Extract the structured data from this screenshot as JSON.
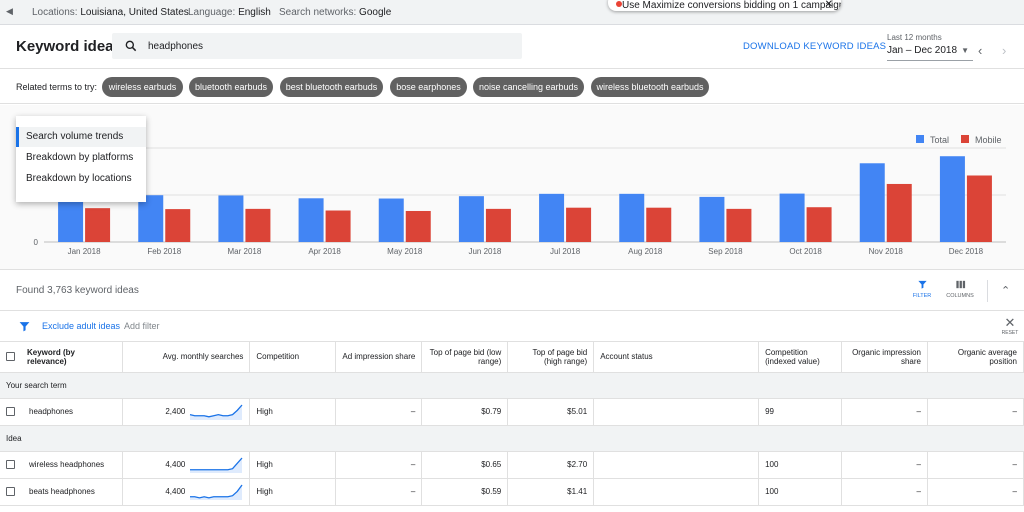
{
  "topbar": {
    "location_label": "Locations:",
    "location_value": "Louisiana, United States",
    "language_label": "Language:",
    "language_value": "English",
    "networks_label": "Search networks:",
    "networks_value": "Google",
    "toast_text": "Use Maximize conversions bidding on 1 campaign"
  },
  "header": {
    "title": "Keyword ideas",
    "search_value": "headphones",
    "download_label": "DOWNLOAD KEYWORD IDEAS",
    "range_label": "Last 12 months",
    "range_value": "Jan – Dec 2018"
  },
  "related": {
    "label": "Related terms to try:",
    "chips": [
      "wireless earbuds",
      "bluetooth earbuds",
      "best bluetooth earbuds",
      "bose earphones",
      "noise cancelling earbuds",
      "wireless bluetooth earbuds"
    ]
  },
  "chart_menu": {
    "items": [
      "Search volume trends",
      "Breakdown by platforms",
      "Breakdown by locations"
    ],
    "active_index": 0
  },
  "chart_data": {
    "type": "bar",
    "categories": [
      "Jan 2018",
      "Feb 2018",
      "Mar 2018",
      "Apr 2018",
      "May 2018",
      "Jun 2018",
      "Jul 2018",
      "Aug 2018",
      "Sep 2018",
      "Oct 2018",
      "Nov 2018",
      "Dec 2018"
    ],
    "series": [
      {
        "name": "Total",
        "color": "#4285f4",
        "values": [
          2000,
          1990,
          1980,
          1860,
          1850,
          1950,
          2050,
          2050,
          1920,
          2060,
          3350,
          3650
        ]
      },
      {
        "name": "Mobile",
        "color": "#db4437",
        "values": [
          1440,
          1400,
          1410,
          1340,
          1320,
          1410,
          1460,
          1460,
          1410,
          1480,
          2470,
          2830
        ]
      }
    ],
    "ylim": [
      0,
      4000
    ],
    "y_ticks": [
      "0"
    ],
    "legend": "top-right",
    "grid": true
  },
  "results": {
    "found_text": "Found 3,763 keyword ideas",
    "filter_label": "FILTER",
    "columns_label": "COLUMNS",
    "exclude_label": "Exclude adult ideas",
    "add_filter_label": "Add filter",
    "reset_label": "RESET"
  },
  "table": {
    "headers": [
      "Keyword (by relevance)",
      "Avg. monthly searches",
      "Competition",
      "Ad impression share",
      "Top of page bid (low range)",
      "Top of page bid (high range)",
      "Account status",
      "Competition (indexed value)",
      "Organic impression share",
      "Organic average position"
    ],
    "group_search_term": "Your search term",
    "group_idea": "Idea",
    "rows": [
      {
        "keyword": "headphones",
        "searches": "2,400",
        "competition": "High",
        "ad_share": "–",
        "bid_low": "$0.79",
        "bid_high": "$5.01",
        "account_status": "",
        "comp_index": "99",
        "organic_share": "–",
        "organic_pos": "–",
        "trend": [
          5,
          4,
          4,
          4,
          3,
          4,
          5,
          4,
          4,
          5,
          9,
          14
        ]
      },
      {
        "keyword": "wireless headphones",
        "searches": "4,400",
        "competition": "High",
        "ad_share": "–",
        "bid_low": "$0.65",
        "bid_high": "$2.70",
        "account_status": "",
        "comp_index": "100",
        "organic_share": "–",
        "organic_pos": "–",
        "trend": [
          3,
          3,
          3,
          3,
          3,
          3,
          3,
          3,
          3,
          4,
          9,
          14
        ]
      },
      {
        "keyword": "beats headphones",
        "searches": "4,400",
        "competition": "High",
        "ad_share": "–",
        "bid_low": "$0.59",
        "bid_high": "$1.41",
        "account_status": "",
        "comp_index": "100",
        "organic_share": "–",
        "organic_pos": "–",
        "trend": [
          3,
          3,
          2,
          3,
          2,
          3,
          3,
          3,
          3,
          4,
          8,
          14
        ]
      }
    ]
  }
}
